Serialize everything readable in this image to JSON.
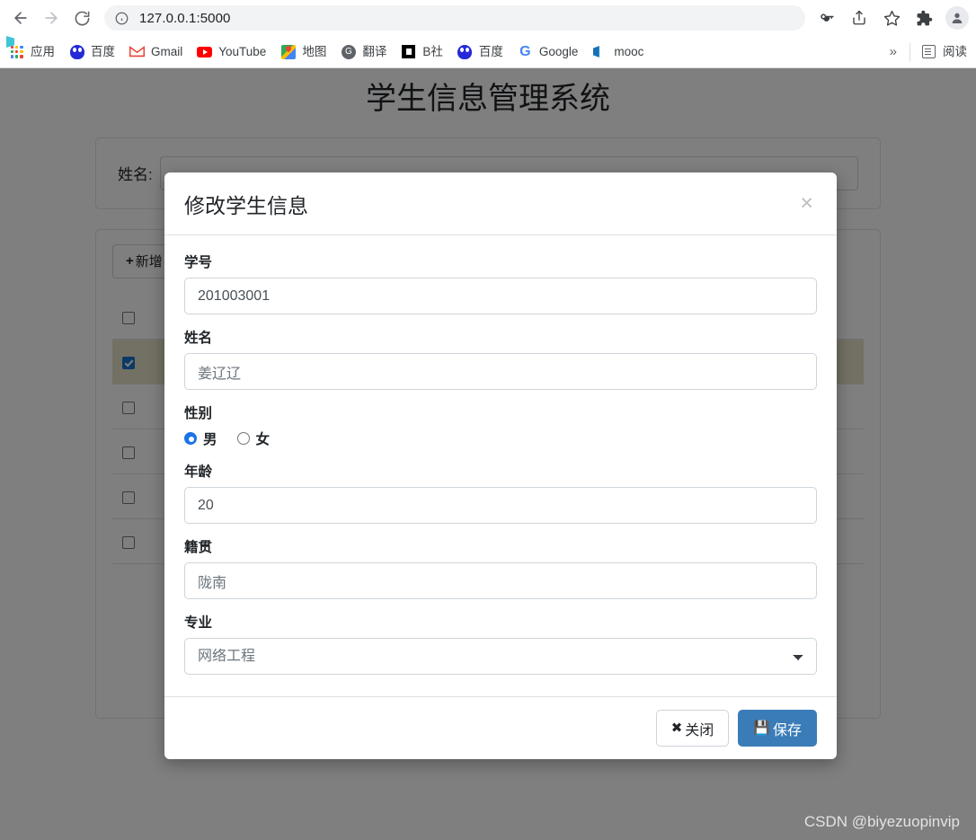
{
  "browser": {
    "url": "127.0.0.1:5000",
    "nav": {
      "back": "back-arrow",
      "forward": "forward-arrow",
      "reload": "reload"
    },
    "toolbar_icons": [
      "key-icon",
      "share-icon",
      "star-icon",
      "extensions-icon",
      "profile-avatar"
    ],
    "bookmarks": [
      {
        "label": "应用",
        "icon": "apps-grid-icon"
      },
      {
        "label": "百度",
        "icon": "baidu-icon"
      },
      {
        "label": "Gmail",
        "icon": "gmail-icon"
      },
      {
        "label": "YouTube",
        "icon": "youtube-icon"
      },
      {
        "label": "地图",
        "icon": "google-maps-icon"
      },
      {
        "label": "翻译",
        "icon": "translate-icon"
      },
      {
        "label": "B社",
        "icon": "bilibili-icon"
      },
      {
        "label": "百度",
        "icon": "baidu-icon"
      },
      {
        "label": "Google",
        "icon": "google-icon"
      },
      {
        "label": "mooc",
        "icon": "mooc-icon"
      }
    ],
    "overflow_label": "»",
    "reading_list_label": "阅读"
  },
  "page": {
    "title": "学生信息管理系统",
    "search_label": "姓名:",
    "add_button": "新增",
    "add_button_plus": "+",
    "rows": [
      {
        "checked": false,
        "selected": false
      },
      {
        "checked": true,
        "selected": true
      },
      {
        "checked": false,
        "selected": false
      },
      {
        "checked": false,
        "selected": false
      },
      {
        "checked": false,
        "selected": false
      },
      {
        "checked": false,
        "selected": false
      }
    ]
  },
  "modal": {
    "title": "修改学生信息",
    "close_glyph": "×",
    "fields": {
      "student_id": {
        "label": "学号",
        "value": "201003001"
      },
      "name": {
        "label": "姓名",
        "value": "姜辽辽"
      },
      "gender": {
        "label": "性别",
        "options": [
          {
            "label": "男",
            "selected": true
          },
          {
            "label": "女",
            "selected": false
          }
        ]
      },
      "age": {
        "label": "年龄",
        "value": "20"
      },
      "hometown": {
        "label": "籍贯",
        "value": "陇南"
      },
      "major": {
        "label": "专业",
        "value": "网络工程"
      }
    },
    "buttons": {
      "close": {
        "label": "关闭",
        "icon": "✖"
      },
      "save": {
        "label": "保存",
        "icon": "💾"
      }
    }
  },
  "watermark": "CSDN @biyezuopinvip",
  "colors": {
    "accent": "#3a7cb8",
    "radio_on": "#1a73e8",
    "checkbox_on": "#1a73cf",
    "selected_row": "#e6e2c8"
  }
}
